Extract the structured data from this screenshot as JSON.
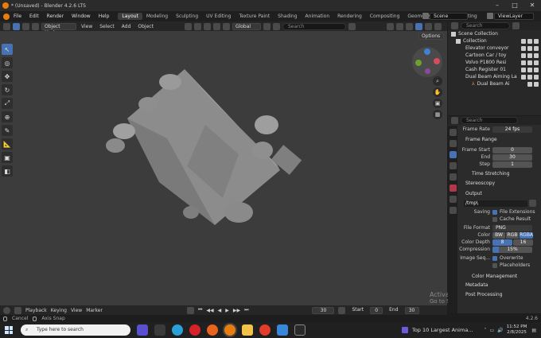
{
  "window": {
    "title": "* (Unsaved) - Blender 4.2.6 LTS"
  },
  "menu": {
    "items": [
      "File",
      "Edit",
      "Render",
      "Window",
      "Help"
    ],
    "workspaces": [
      "Layout",
      "Modeling",
      "Sculpting",
      "UV Editing",
      "Texture Paint",
      "Shading",
      "Animation",
      "Rendering",
      "Compositing",
      "Geometry Nodes",
      "Scripting"
    ],
    "active_workspace": "Layout",
    "scene": "Scene",
    "view_layer": "ViewLayer"
  },
  "viewport_header": {
    "mode": "Object Mode",
    "menus": [
      "View",
      "Select",
      "Add",
      "Object"
    ],
    "transform": "Global",
    "search_placeholder": "Search",
    "options": "Options"
  },
  "outliner": {
    "search_placeholder": "Search",
    "root": "Scene Collection",
    "rows": [
      {
        "label": "Collection",
        "depth": 1
      },
      {
        "label": "Elevator conveyor",
        "depth": 2
      },
      {
        "label": "Cartoon Car / toy",
        "depth": 2
      },
      {
        "label": "Volvo P1800 Resi",
        "depth": 2
      },
      {
        "label": "Cash Register 01",
        "depth": 1
      },
      {
        "label": "Dual Beam Aiming La",
        "depth": 1
      },
      {
        "label": "Dual Beam Ai",
        "depth": 2
      }
    ]
  },
  "properties": {
    "search_placeholder": "Search",
    "frame_rate_label": "Frame Rate",
    "frame_rate": "24 fps",
    "frame_range": {
      "title": "Frame Range",
      "start_label": "Frame Start",
      "start": "0",
      "end_label": "End",
      "end": "30",
      "step_label": "Step",
      "step": "1"
    },
    "time_stretching": "Time Stretching",
    "stereoscopy": "Stereoscopy",
    "output": {
      "title": "Output",
      "path": "/tmp\\",
      "saving_label": "Saving",
      "file_extensions": "File Extensions",
      "cache_result": "Cache Result",
      "file_format_label": "File Format",
      "file_format": "PNG",
      "color_label": "Color",
      "color_options": [
        "BW",
        "RGB",
        "RGBA"
      ],
      "color_active": "RGBA",
      "color_depth_label": "Color Depth",
      "color_depth_options": [
        "8",
        "16"
      ],
      "compression_label": "Compression",
      "compression": "15%",
      "compression_value": 0.15,
      "image_seq_label": "Image Seq...",
      "overwrite": "Overwrite",
      "placeholders": "Placeholders"
    },
    "color_management": "Color Management",
    "metadata": "Metadata",
    "post_processing": "Post Processing"
  },
  "timeline": {
    "menus": [
      "Playback",
      "Keying",
      "View",
      "Marker"
    ],
    "current_frame": "30",
    "start_label": "Start",
    "start": "0",
    "end_label": "End",
    "end": "30"
  },
  "statusbar": {
    "items": [
      "Cancel",
      "Axis Snap"
    ],
    "version": "4.2.6"
  },
  "watermark": {
    "title": "Activate Windows",
    "subtitle": "Go to Settings to activate Windows."
  },
  "taskbar": {
    "search_placeholder": "Type here to search",
    "media": "Top 10 Largest Anima...",
    "time": "11:52 PM",
    "date": "2/8/2025"
  },
  "colors": {
    "accent": "#4772b3",
    "viewport_bg": "#3c3c3c",
    "panel": "#2b2b2b"
  }
}
